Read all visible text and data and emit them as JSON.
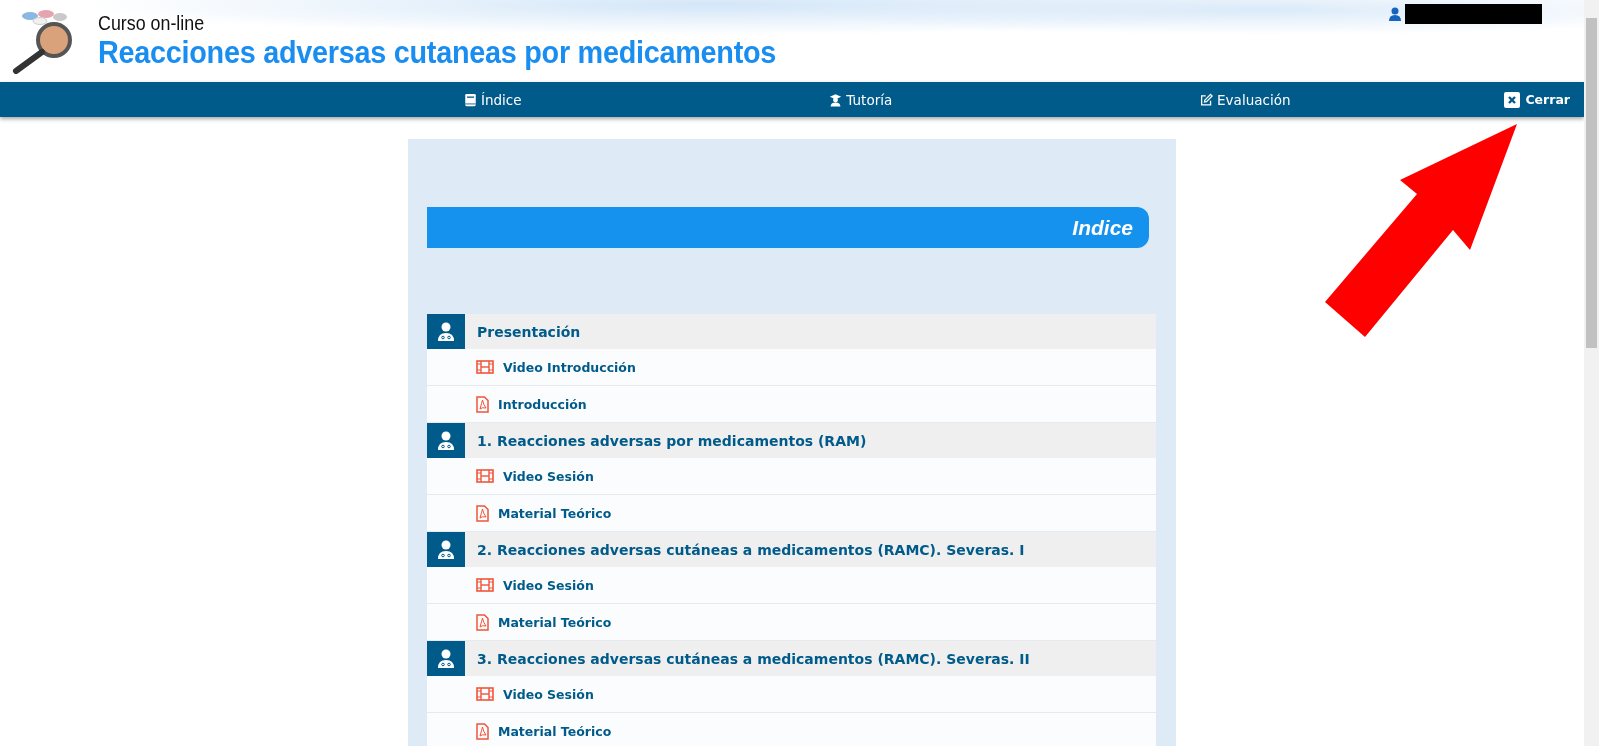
{
  "header": {
    "kicker": "Curso on-line",
    "title": "Reacciones adversas cutaneas por medicamentos"
  },
  "nav": [
    {
      "label": "Índice",
      "kind": "book"
    },
    {
      "label": "Tutoría",
      "kind": "tutor"
    },
    {
      "label": "Evaluación",
      "kind": "edit"
    }
  ],
  "close": {
    "label": "Cerrar"
  },
  "index_title": "Indice",
  "sections": [
    {
      "title": "Presentación",
      "items": [
        {
          "kind": "video",
          "label": "Video Introducción"
        },
        {
          "kind": "pdf",
          "label": "Introducción"
        }
      ]
    },
    {
      "title": "1. Reacciones adversas por medicamentos (RAM)",
      "items": [
        {
          "kind": "video",
          "label": "Video Sesión"
        },
        {
          "kind": "pdf",
          "label": "Material Teórico"
        }
      ]
    },
    {
      "title": "2. Reacciones adversas cutáneas a medicamentos (RAMC). Severas. I",
      "items": [
        {
          "kind": "video",
          "label": "Video Sesión"
        },
        {
          "kind": "pdf",
          "label": "Material Teórico"
        }
      ]
    },
    {
      "title": "3. Reacciones adversas cutáneas a medicamentos (RAMC). Severas. II",
      "items": [
        {
          "kind": "video",
          "label": "Video Sesión"
        },
        {
          "kind": "pdf",
          "label": "Material Teórico"
        }
      ]
    }
  ]
}
